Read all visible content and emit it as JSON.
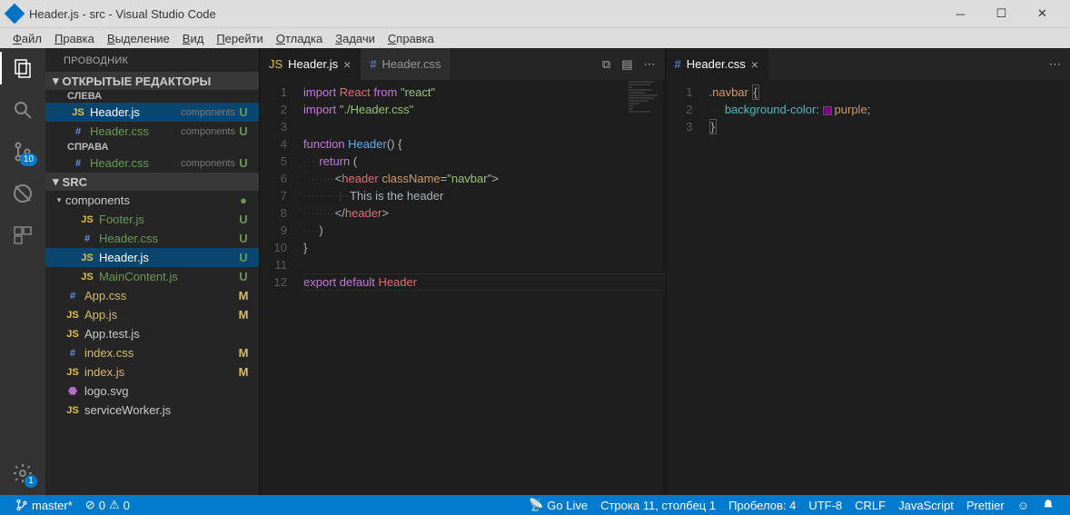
{
  "window": {
    "title": "Header.js - src - Visual Studio Code"
  },
  "menu": {
    "items": [
      "Файл",
      "Правка",
      "Выделение",
      "Вид",
      "Перейти",
      "Отладка",
      "Задачи",
      "Справка"
    ]
  },
  "activity": {
    "scm_badge": "10",
    "settings_badge": "1"
  },
  "sidebar": {
    "title": "ПРОВОДНИК",
    "open_editors": {
      "label": "ОТКРЫТЫЕ РЕДАКТОРЫ",
      "groups": [
        {
          "label": "СЛЕВА",
          "items": [
            {
              "icon": "JS",
              "iconcls": "ico-js",
              "name": "Header.js",
              "path": "components",
              "status": "U",
              "selected": true,
              "green": true
            },
            {
              "icon": "#",
              "iconcls": "ico-css",
              "name": "Header.css",
              "path": "components",
              "status": "U",
              "green": true
            }
          ]
        },
        {
          "label": "СПРАВА",
          "items": [
            {
              "icon": "#",
              "iconcls": "ico-css",
              "name": "Header.css",
              "path": "components",
              "status": "U",
              "green": true
            }
          ]
        }
      ]
    },
    "folder": {
      "label": "SRC",
      "items": [
        {
          "type": "folder",
          "name": "components",
          "expanded": true,
          "dot": true,
          "children": [
            {
              "icon": "JS",
              "iconcls": "ico-js",
              "name": "Footer.js",
              "status": "U",
              "green": true
            },
            {
              "icon": "#",
              "iconcls": "ico-css",
              "name": "Header.css",
              "status": "U",
              "green": true
            },
            {
              "icon": "JS",
              "iconcls": "ico-js",
              "name": "Header.js",
              "status": "U",
              "selected": true,
              "green": true
            },
            {
              "icon": "JS",
              "iconcls": "ico-js",
              "name": "MainContent.js",
              "status": "U",
              "green": true
            }
          ]
        },
        {
          "icon": "#",
          "iconcls": "ico-css",
          "name": "App.css",
          "status": "M",
          "mod": true
        },
        {
          "icon": "JS",
          "iconcls": "ico-js",
          "name": "App.js",
          "status": "M",
          "mod": true
        },
        {
          "icon": "JS",
          "iconcls": "ico-js",
          "name": "App.test.js"
        },
        {
          "icon": "#",
          "iconcls": "ico-css",
          "name": "index.css",
          "status": "M",
          "mod": true
        },
        {
          "icon": "JS",
          "iconcls": "ico-js",
          "name": "index.js",
          "status": "M",
          "mod": true
        },
        {
          "icon": "⬣",
          "iconcls": "ico-svg",
          "name": "logo.svg"
        },
        {
          "icon": "JS",
          "iconcls": "ico-js",
          "name": "serviceWorker.js"
        }
      ]
    }
  },
  "editors": {
    "left": {
      "tabs": [
        {
          "icon": "JS",
          "iconcls": "ico-js",
          "name": "Header.js",
          "active": true,
          "closable": true
        },
        {
          "icon": "#",
          "iconcls": "ico-css",
          "name": "Header.css",
          "active": false
        }
      ],
      "lines": [
        {
          "n": 1,
          "html": "<span class='kw'>import</span> <span class='var'>React</span> <span class='kw'>from</span> <span class='str'>\"react\"</span>"
        },
        {
          "n": 2,
          "html": "<span class='kw'>import</span> <span class='str'>\"./Header.css\"</span>"
        },
        {
          "n": 3,
          "html": ""
        },
        {
          "n": 4,
          "html": "<span class='kw'>function</span> <span class='fn'>Header</span><span class='punc'>()</span> <span class='punc'>{</span>"
        },
        {
          "n": 5,
          "html": "<span class='ws-dot'>····</span><span class='kw'>return</span> <span class='punc'>(</span>"
        },
        {
          "n": 6,
          "html": "<span class='ws-dot'>········</span><span class='punc'>&lt;</span><span class='tag'>header</span> <span class='attr'>className</span><span class='punc'>=</span><span class='str'>\"navbar\"</span><span class='punc'>&gt;</span>"
        },
        {
          "n": 7,
          "html": "<span class='ws-dot'>········</span><span class='ws-dot'>·|··</span><span class='punc'>This is the header</span>"
        },
        {
          "n": 8,
          "html": "<span class='ws-dot'>········</span><span class='punc'>&lt;/</span><span class='tag'>header</span><span class='punc'>&gt;</span>"
        },
        {
          "n": 9,
          "html": "<span class='ws-dot'>····</span><span class='punc'>)</span>"
        },
        {
          "n": 10,
          "html": "<span class='punc'>}</span>"
        },
        {
          "n": 11,
          "html": "",
          "cursor": true
        },
        {
          "n": 12,
          "html": "<span class='kw'>export</span> <span class='kw'>default</span> <span class='var'>Header</span>"
        }
      ]
    },
    "right": {
      "tabs": [
        {
          "icon": "#",
          "iconcls": "ico-css",
          "name": "Header.css",
          "active": true,
          "closable": true
        }
      ],
      "lines": [
        {
          "n": 1,
          "html": "<span class='sel'>.navbar</span> <span class='brace-box punc'>{</span>"
        },
        {
          "n": 2,
          "html": "<span class='ws-dot'>····</span><span class='prop'>background-color</span><span class='punc'>:</span> <span class='css-swatch'></span><span class='attr'>purple</span><span class='punc'>;</span>"
        },
        {
          "n": 3,
          "html": "<span class='brace-box punc'>}</span>"
        }
      ]
    }
  },
  "status": {
    "branch": "master*",
    "errors": "0",
    "warnings": "0",
    "golive": "Go Live",
    "cursor": "Строка 11, столбец 1",
    "spaces": "Пробелов: 4",
    "encoding": "UTF-8",
    "eol": "CRLF",
    "lang": "JavaScript",
    "prettier": "Prettier"
  }
}
